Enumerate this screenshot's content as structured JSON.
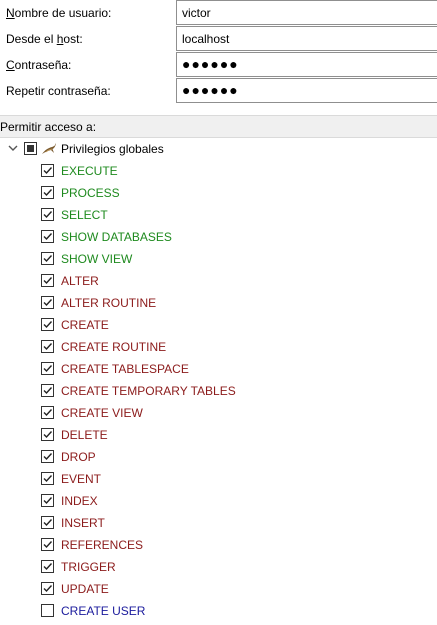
{
  "form": {
    "username": {
      "label": "Nombre de usuario:",
      "value": "victor"
    },
    "host": {
      "label": "Desde el host:",
      "value": "localhost"
    },
    "password": {
      "label": "Contraseña:",
      "value": "●●●●●●"
    },
    "repeat_password": {
      "label": "Repetir contraseña:",
      "value": "●●●●●●"
    }
  },
  "access": {
    "section_label": "Permitir acceso a:",
    "root": {
      "label": "Privilegios globales",
      "icon": "sakila-dolphin-icon"
    },
    "colors": {
      "green": "#1e8a1e",
      "red": "#8b1a1a",
      "blue": "#1a1a9c"
    },
    "privileges": [
      {
        "label": "EXECUTE",
        "checked": true,
        "color": "green"
      },
      {
        "label": "PROCESS",
        "checked": true,
        "color": "green"
      },
      {
        "label": "SELECT",
        "checked": true,
        "color": "green"
      },
      {
        "label": "SHOW DATABASES",
        "checked": true,
        "color": "green"
      },
      {
        "label": "SHOW VIEW",
        "checked": true,
        "color": "green"
      },
      {
        "label": "ALTER",
        "checked": true,
        "color": "red"
      },
      {
        "label": "ALTER ROUTINE",
        "checked": true,
        "color": "red"
      },
      {
        "label": "CREATE",
        "checked": true,
        "color": "red"
      },
      {
        "label": "CREATE ROUTINE",
        "checked": true,
        "color": "red"
      },
      {
        "label": "CREATE TABLESPACE",
        "checked": true,
        "color": "red"
      },
      {
        "label": "CREATE TEMPORARY TABLES",
        "checked": true,
        "color": "red"
      },
      {
        "label": "CREATE VIEW",
        "checked": true,
        "color": "red"
      },
      {
        "label": "DELETE",
        "checked": true,
        "color": "red"
      },
      {
        "label": "DROP",
        "checked": true,
        "color": "red"
      },
      {
        "label": "EVENT",
        "checked": true,
        "color": "red"
      },
      {
        "label": "INDEX",
        "checked": true,
        "color": "red"
      },
      {
        "label": "INSERT",
        "checked": true,
        "color": "red"
      },
      {
        "label": "REFERENCES",
        "checked": true,
        "color": "red"
      },
      {
        "label": "TRIGGER",
        "checked": true,
        "color": "red"
      },
      {
        "label": "UPDATE",
        "checked": true,
        "color": "red"
      },
      {
        "label": "CREATE USER",
        "checked": false,
        "color": "blue"
      }
    ]
  }
}
